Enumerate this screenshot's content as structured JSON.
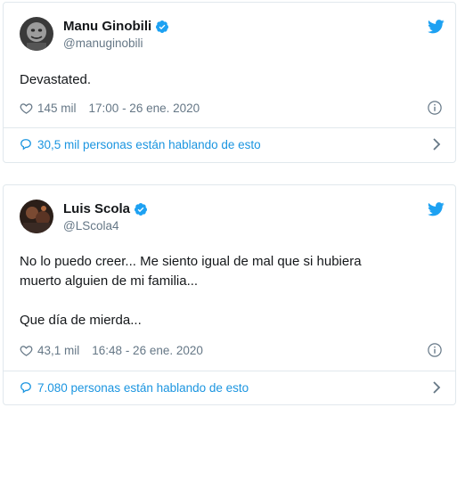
{
  "tweets": [
    {
      "display_name": "Manu Ginobili",
      "handle": "@manuginobili",
      "text": "Devastated.",
      "likes": "145 mil",
      "timestamp": "17:00 - 26 ene. 2020",
      "conversation": "30,5 mil personas están hablando de esto",
      "verified": true
    },
    {
      "display_name": "Luis Scola",
      "handle": "@LScola4",
      "text": "No lo puedo creer... Me siento igual de mal que si hubiera\nmuerto alguien de mi familia...\n\nQue día de mierda...",
      "likes": "43,1 mil",
      "timestamp": "16:48 - 26 ene. 2020",
      "conversation": "7.080 personas están hablando de esto",
      "verified": true
    }
  ],
  "colors": {
    "twitter_blue": "#1da1f2",
    "link_blue": "#1b95e0",
    "text_primary": "#14171a",
    "text_secondary": "#657786",
    "border": "#e1e8ed"
  },
  "icons": [
    "avatar",
    "verified-badge-icon",
    "twitter-bird-icon",
    "heart-icon",
    "info-icon",
    "speech-bubble-icon",
    "chevron-right-icon"
  ]
}
